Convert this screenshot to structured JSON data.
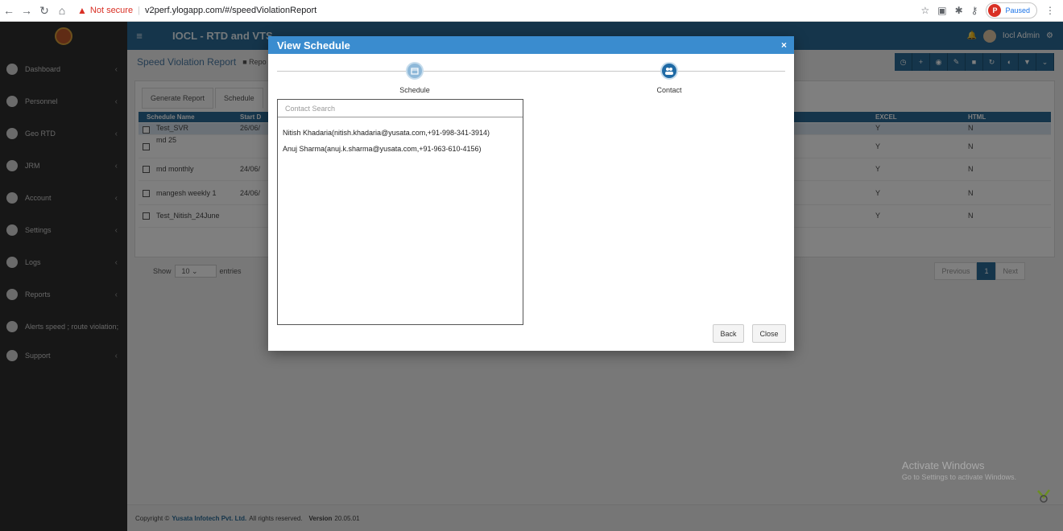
{
  "browser": {
    "not_secure": "Not secure",
    "url": "v2perf.ylogapp.com/#/speedViolationReport",
    "paused": "Paused",
    "profile_initial": "P"
  },
  "app": {
    "title": "IOCL - RTD and VTS",
    "user": "Iocl Admin"
  },
  "sidebar": {
    "items": [
      {
        "label": "Dashboard",
        "icon": "dashboard-icon"
      },
      {
        "label": "Personnel",
        "icon": "users-icon"
      },
      {
        "label": "Geo RTD",
        "icon": "map-marker-icon"
      },
      {
        "label": "JRM",
        "icon": "globe-icon"
      },
      {
        "label": "Account",
        "icon": "thermometer-icon"
      },
      {
        "label": "Settings",
        "icon": "gear-icon"
      },
      {
        "label": "Logs",
        "icon": "clock-icon"
      },
      {
        "label": "Reports",
        "icon": "list-icon"
      },
      {
        "label": "Alerts speed ; route violation;",
        "icon": "bell-icon"
      },
      {
        "label": "Support",
        "icon": "support-icon"
      }
    ]
  },
  "page": {
    "title": "Speed Violation Report",
    "crumb": "Repo",
    "tabs": [
      "Generate Report",
      "Schedule"
    ],
    "columns": [
      "Schedule Name",
      "Start D",
      "EXCEL",
      "HTML"
    ],
    "rows": [
      {
        "name": "Test_SVR",
        "start": "26/06/",
        "excel": "Y",
        "html": "N"
      },
      {
        "name": "md 25",
        "start": "",
        "excel": "Y",
        "html": "N"
      },
      {
        "name": "md monthly",
        "start": "24/06/",
        "excel": "Y",
        "html": "N"
      },
      {
        "name": "mangesh weekly 1",
        "start": "24/06/",
        "excel": "Y",
        "html": "N"
      },
      {
        "name": "Test_Nitish_24June",
        "start": "",
        "excel": "Y",
        "html": "N"
      }
    ],
    "show_label": "Show",
    "entries_value": "10",
    "entries_label": "entries",
    "pager": {
      "previous": "Previous",
      "current": "1",
      "next": "Next"
    }
  },
  "footer": {
    "copyright": "Copyright ©",
    "company": "Yusata Infotech Pvt. Ltd.",
    "rights": "All rights reserved.",
    "version_label": "Version",
    "version": "20.05.01"
  },
  "windows": {
    "title": "Activate Windows",
    "subtitle": "Go to Settings to activate Windows."
  },
  "modal": {
    "title": "View Schedule",
    "close_glyph": "×",
    "steps": [
      {
        "label": "Schedule",
        "icon": "calendar-icon"
      },
      {
        "label": "Contact",
        "icon": "users-icon"
      }
    ],
    "search_placeholder": "Contact Search",
    "contacts": [
      "Nitish Khadaria(nitish.khadaria@yusata.com,+91-998-341-3914)",
      "Anuj Sharma(anuj.k.sharma@yusata.com,+91-963-610-4156)"
    ],
    "back_label": "Back",
    "close_label": "Close"
  }
}
